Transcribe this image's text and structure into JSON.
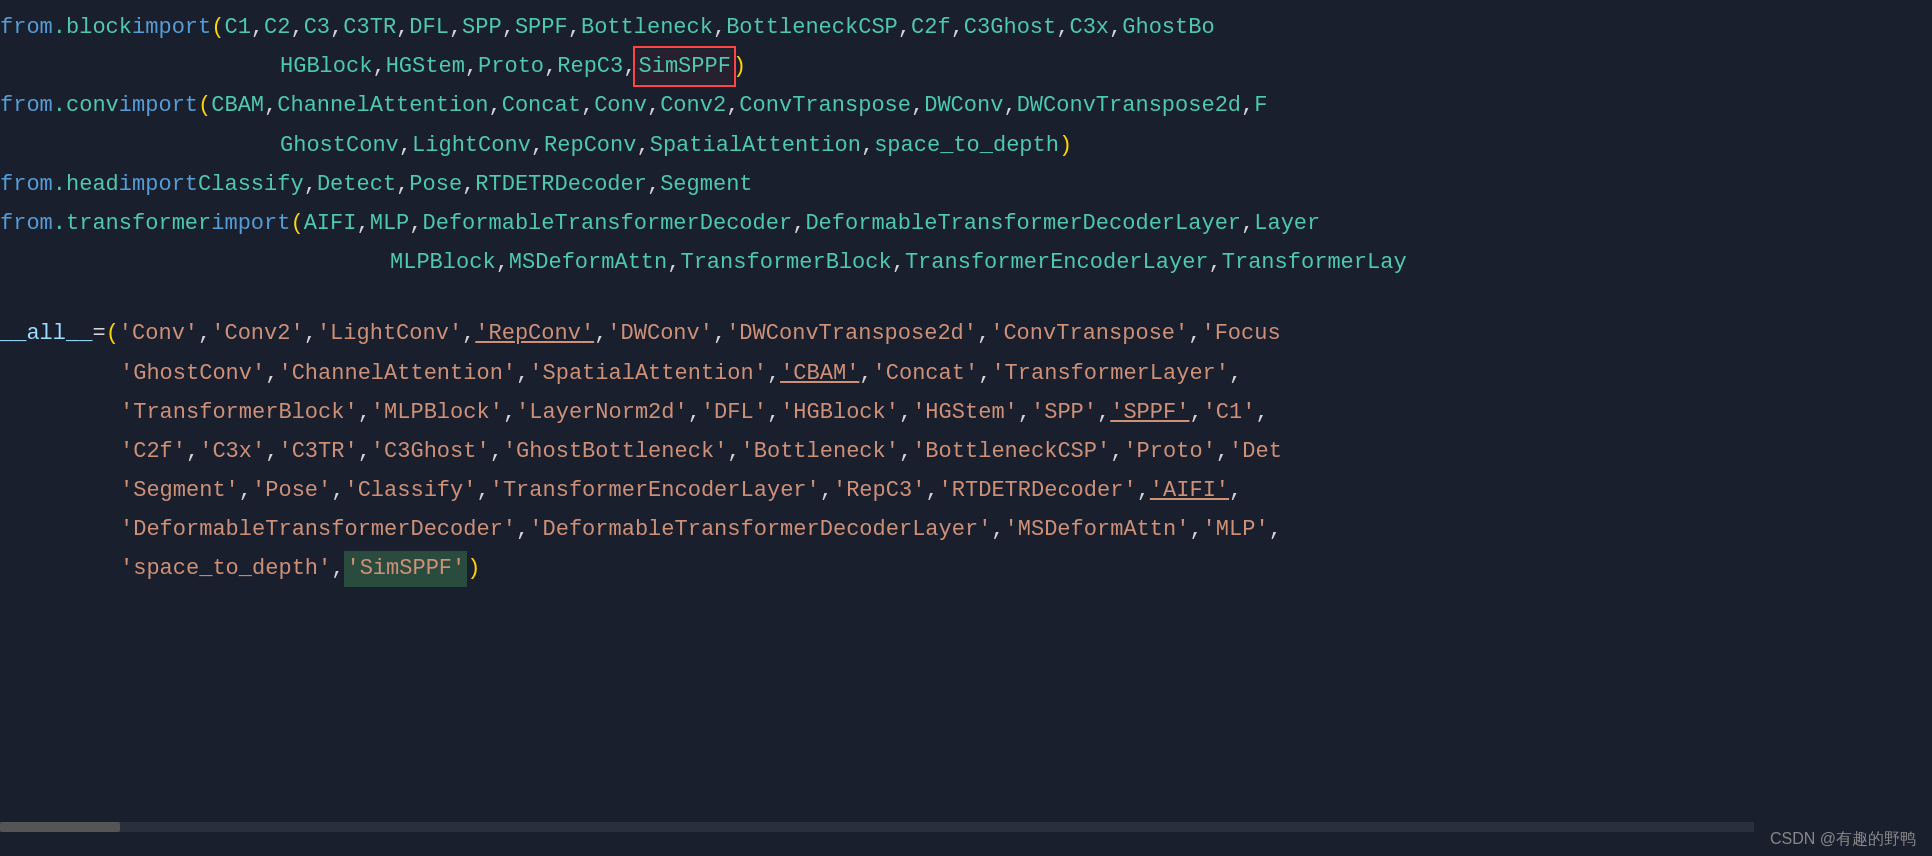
{
  "editor": {
    "background": "#1a1f2e",
    "lines": [
      {
        "id": "line1",
        "parts": [
          {
            "type": "kw-from",
            "text": "from"
          },
          {
            "type": "space",
            "text": " "
          },
          {
            "type": "module",
            "text": ".block"
          },
          {
            "type": "space",
            "text": " "
          },
          {
            "type": "kw-import",
            "text": "import"
          },
          {
            "type": "space",
            "text": " "
          },
          {
            "type": "paren",
            "text": "("
          },
          {
            "type": "classname",
            "text": "C1"
          },
          {
            "type": "comma",
            "text": ", "
          },
          {
            "type": "classname",
            "text": "C2"
          },
          {
            "type": "comma",
            "text": ", "
          },
          {
            "type": "classname",
            "text": "C3"
          },
          {
            "type": "comma",
            "text": ", "
          },
          {
            "type": "classname",
            "text": "C3TR"
          },
          {
            "type": "comma",
            "text": ", "
          },
          {
            "type": "classname",
            "text": "DFL"
          },
          {
            "type": "comma",
            "text": ", "
          },
          {
            "type": "classname",
            "text": "SPP"
          },
          {
            "type": "comma",
            "text": ", "
          },
          {
            "type": "classname",
            "text": "SPPF"
          },
          {
            "type": "comma",
            "text": ", "
          },
          {
            "type": "classname",
            "text": "Bottleneck"
          },
          {
            "type": "comma",
            "text": ", "
          },
          {
            "type": "classname",
            "text": "BottleneckCSP"
          },
          {
            "type": "comma",
            "text": ", "
          },
          {
            "type": "classname",
            "text": "C2f"
          },
          {
            "type": "comma",
            "text": ", "
          },
          {
            "type": "classname",
            "text": "C3Ghost"
          },
          {
            "type": "comma",
            "text": ", "
          },
          {
            "type": "classname",
            "text": "C3x"
          },
          {
            "type": "comma",
            "text": ", "
          },
          {
            "type": "classname",
            "text": "GhostBo"
          }
        ]
      },
      {
        "id": "line2",
        "parts": [
          {
            "type": "indent-large",
            "text": "                    "
          },
          {
            "type": "classname",
            "text": "HGBlock"
          },
          {
            "type": "comma",
            "text": ", "
          },
          {
            "type": "classname",
            "text": "HGStem"
          },
          {
            "type": "comma",
            "text": ", "
          },
          {
            "type": "classname",
            "text": "Proto"
          },
          {
            "type": "comma",
            "text": ", "
          },
          {
            "type": "classname",
            "text": "RepC3"
          },
          {
            "type": "comma",
            "text": ", "
          },
          {
            "type": "classname-highlighted",
            "text": "SimSPPF"
          },
          {
            "type": "paren",
            "text": ")"
          }
        ]
      },
      {
        "id": "line3",
        "parts": [
          {
            "type": "kw-from",
            "text": "from"
          },
          {
            "type": "space",
            "text": " "
          },
          {
            "type": "module",
            "text": ".conv"
          },
          {
            "type": "space",
            "text": " "
          },
          {
            "type": "kw-import",
            "text": "import"
          },
          {
            "type": "space",
            "text": " "
          },
          {
            "type": "paren",
            "text": "("
          },
          {
            "type": "classname",
            "text": "CBAM"
          },
          {
            "type": "comma",
            "text": ", "
          },
          {
            "type": "classname",
            "text": "ChannelAttention"
          },
          {
            "type": "comma",
            "text": ", "
          },
          {
            "type": "classname",
            "text": "Concat"
          },
          {
            "type": "comma",
            "text": ", "
          },
          {
            "type": "classname",
            "text": "Conv"
          },
          {
            "type": "comma",
            "text": ", "
          },
          {
            "type": "classname",
            "text": "Conv2"
          },
          {
            "type": "comma",
            "text": ", "
          },
          {
            "type": "classname",
            "text": "ConvTranspose"
          },
          {
            "type": "comma",
            "text": ", "
          },
          {
            "type": "classname",
            "text": "DWConv"
          },
          {
            "type": "comma",
            "text": ", "
          },
          {
            "type": "classname",
            "text": "DWConvTranspose2d"
          },
          {
            "type": "comma",
            "text": ", "
          },
          {
            "type": "classname",
            "text": "F"
          }
        ]
      },
      {
        "id": "line4",
        "parts": [
          {
            "type": "indent-large",
            "text": "                    "
          },
          {
            "type": "classname",
            "text": "GhostConv"
          },
          {
            "type": "comma",
            "text": ", "
          },
          {
            "type": "classname",
            "text": "LightConv"
          },
          {
            "type": "comma",
            "text": ", "
          },
          {
            "type": "classname",
            "text": "RepConv"
          },
          {
            "type": "comma",
            "text": ", "
          },
          {
            "type": "classname",
            "text": "SpatialAttention"
          },
          {
            "type": "comma",
            "text": ", "
          },
          {
            "type": "classname",
            "text": "space_to_depth"
          },
          {
            "type": "paren",
            "text": ")"
          }
        ]
      },
      {
        "id": "line5",
        "parts": [
          {
            "type": "kw-from",
            "text": "from"
          },
          {
            "type": "space",
            "text": " "
          },
          {
            "type": "module",
            "text": ".head"
          },
          {
            "type": "space",
            "text": " "
          },
          {
            "type": "kw-import",
            "text": "import"
          },
          {
            "type": "space",
            "text": " "
          },
          {
            "type": "classname",
            "text": "Classify"
          },
          {
            "type": "comma",
            "text": ", "
          },
          {
            "type": "classname",
            "text": "Detect"
          },
          {
            "type": "comma",
            "text": ", "
          },
          {
            "type": "classname",
            "text": "Pose"
          },
          {
            "type": "comma",
            "text": ", "
          },
          {
            "type": "classname",
            "text": "RTDETRDecoder"
          },
          {
            "type": "comma",
            "text": ", "
          },
          {
            "type": "classname",
            "text": "Segment"
          }
        ]
      },
      {
        "id": "line6",
        "parts": [
          {
            "type": "kw-from",
            "text": "from"
          },
          {
            "type": "space",
            "text": " "
          },
          {
            "type": "module",
            "text": ".transformer"
          },
          {
            "type": "space",
            "text": " "
          },
          {
            "type": "kw-import",
            "text": "import"
          },
          {
            "type": "space",
            "text": " "
          },
          {
            "type": "paren",
            "text": "("
          },
          {
            "type": "classname",
            "text": "AIFI"
          },
          {
            "type": "comma",
            "text": ", "
          },
          {
            "type": "classname",
            "text": "MLP"
          },
          {
            "type": "comma",
            "text": ", "
          },
          {
            "type": "classname",
            "text": "DeformableTransformerDecoder"
          },
          {
            "type": "comma",
            "text": ", "
          },
          {
            "type": "classname",
            "text": "DeformableTransformerDecoderLayer"
          },
          {
            "type": "comma",
            "text": ", "
          },
          {
            "type": "classname",
            "text": "Layer"
          }
        ]
      },
      {
        "id": "line7",
        "parts": [
          {
            "type": "indent-large",
            "text": "                    "
          },
          {
            "type": "classname",
            "text": "MLPBlock"
          },
          {
            "type": "comma",
            "text": ", "
          },
          {
            "type": "classname",
            "text": "MSDeformAttn"
          },
          {
            "type": "comma",
            "text": ", "
          },
          {
            "type": "classname",
            "text": "TransformerBlock"
          },
          {
            "type": "comma",
            "text": ", "
          },
          {
            "type": "classname",
            "text": "TransformerEncoderLayer"
          },
          {
            "type": "comma",
            "text": ", "
          },
          {
            "type": "classname",
            "text": "TransformerLay"
          }
        ]
      },
      {
        "id": "line8-empty",
        "empty": true
      },
      {
        "id": "line9",
        "parts": [
          {
            "type": "variable",
            "text": "__all__"
          },
          {
            "type": "space",
            "text": " "
          },
          {
            "type": "operator",
            "text": "="
          },
          {
            "type": "space",
            "text": " "
          },
          {
            "type": "paren",
            "text": "("
          },
          {
            "type": "string",
            "text": "'Conv'"
          },
          {
            "type": "comma",
            "text": ", "
          },
          {
            "type": "string",
            "text": "'Conv2'"
          },
          {
            "type": "comma",
            "text": ", "
          },
          {
            "type": "string",
            "text": "'LightConv'"
          },
          {
            "type": "comma",
            "text": ", "
          },
          {
            "type": "string-underline",
            "text": "'RepConv'"
          },
          {
            "type": "comma",
            "text": ", "
          },
          {
            "type": "string",
            "text": "'DWConv'"
          },
          {
            "type": "comma",
            "text": ", "
          },
          {
            "type": "string",
            "text": "'DWConvTranspose2d'"
          },
          {
            "type": "comma",
            "text": ", "
          },
          {
            "type": "string",
            "text": "'ConvTranspose'"
          },
          {
            "type": "comma",
            "text": ", "
          },
          {
            "type": "string",
            "text": "'Focus"
          }
        ]
      },
      {
        "id": "line10",
        "parts": [
          {
            "type": "indent-small",
            "text": "        "
          },
          {
            "type": "string",
            "text": "'GhostConv'"
          },
          {
            "type": "comma",
            "text": ", "
          },
          {
            "type": "string",
            "text": "'ChannelAttention'"
          },
          {
            "type": "comma",
            "text": ", "
          },
          {
            "type": "string",
            "text": "'SpatialAttention'"
          },
          {
            "type": "comma",
            "text": ", "
          },
          {
            "type": "string-underline",
            "text": "'CBAM'"
          },
          {
            "type": "comma",
            "text": ", "
          },
          {
            "type": "string",
            "text": "'Concat'"
          },
          {
            "type": "comma",
            "text": ", "
          },
          {
            "type": "string",
            "text": "'TransformerLayer'"
          },
          {
            "type": "comma",
            "text": ","
          }
        ]
      },
      {
        "id": "line11",
        "parts": [
          {
            "type": "indent-small",
            "text": "        "
          },
          {
            "type": "string",
            "text": "'TransformerBlock'"
          },
          {
            "type": "comma",
            "text": ", "
          },
          {
            "type": "string",
            "text": "'MLPBlock'"
          },
          {
            "type": "comma",
            "text": ", "
          },
          {
            "type": "string",
            "text": "'LayerNorm2d'"
          },
          {
            "type": "comma",
            "text": ", "
          },
          {
            "type": "string",
            "text": "'DFL'"
          },
          {
            "type": "comma",
            "text": ", "
          },
          {
            "type": "string",
            "text": "'HGBlock'"
          },
          {
            "type": "comma",
            "text": ", "
          },
          {
            "type": "string",
            "text": "'HGStem'"
          },
          {
            "type": "comma",
            "text": ", "
          },
          {
            "type": "string",
            "text": "'SPP'"
          },
          {
            "type": "comma",
            "text": ", "
          },
          {
            "type": "string-underline",
            "text": "'SPPF'"
          },
          {
            "type": "comma",
            "text": ", "
          },
          {
            "type": "string",
            "text": "'C1'"
          },
          {
            "type": "comma",
            "text": ","
          }
        ]
      },
      {
        "id": "line12",
        "parts": [
          {
            "type": "indent-small",
            "text": "        "
          },
          {
            "type": "string",
            "text": "'C2f'"
          },
          {
            "type": "comma",
            "text": ", "
          },
          {
            "type": "string",
            "text": "'C3x'"
          },
          {
            "type": "comma",
            "text": ", "
          },
          {
            "type": "string",
            "text": "'C3TR'"
          },
          {
            "type": "comma",
            "text": ", "
          },
          {
            "type": "string",
            "text": "'C3Ghost'"
          },
          {
            "type": "comma",
            "text": ", "
          },
          {
            "type": "string",
            "text": "'GhostBottleneck'"
          },
          {
            "type": "comma",
            "text": ", "
          },
          {
            "type": "string",
            "text": "'Bottleneck'"
          },
          {
            "type": "comma",
            "text": ", "
          },
          {
            "type": "string",
            "text": "'BottleneckCSP'"
          },
          {
            "type": "comma",
            "text": ", "
          },
          {
            "type": "string",
            "text": "'Proto'"
          },
          {
            "type": "comma",
            "text": ", "
          },
          {
            "type": "string",
            "text": "'Det"
          }
        ]
      },
      {
        "id": "line13",
        "parts": [
          {
            "type": "indent-small",
            "text": "        "
          },
          {
            "type": "string",
            "text": "'Segment'"
          },
          {
            "type": "comma",
            "text": ", "
          },
          {
            "type": "string",
            "text": "'Pose'"
          },
          {
            "type": "comma",
            "text": ", "
          },
          {
            "type": "string",
            "text": "'Classify'"
          },
          {
            "type": "comma",
            "text": ", "
          },
          {
            "type": "string",
            "text": "'TransformerEncoderLayer'"
          },
          {
            "type": "comma",
            "text": ", "
          },
          {
            "type": "string",
            "text": "'RepC3'"
          },
          {
            "type": "comma",
            "text": ", "
          },
          {
            "type": "string",
            "text": "'RTDETRDecoder'"
          },
          {
            "type": "comma",
            "text": ", "
          },
          {
            "type": "string-underline",
            "text": "'AIFI'"
          },
          {
            "type": "comma",
            "text": ","
          }
        ]
      },
      {
        "id": "line14",
        "parts": [
          {
            "type": "indent-small",
            "text": "        "
          },
          {
            "type": "string",
            "text": "'DeformableTransformerDecoder'"
          },
          {
            "type": "comma",
            "text": ", "
          },
          {
            "type": "string",
            "text": "'DeformableTransformerDecoderLayer'"
          },
          {
            "type": "comma",
            "text": ", "
          },
          {
            "type": "string",
            "text": "'MSDeformAttn'"
          },
          {
            "type": "comma",
            "text": ", "
          },
          {
            "type": "string",
            "text": "'MLP'"
          },
          {
            "type": "comma",
            "text": ","
          }
        ]
      },
      {
        "id": "line15",
        "parts": [
          {
            "type": "indent-small",
            "text": "        "
          },
          {
            "type": "string",
            "text": "'space_to_depth'"
          },
          {
            "type": "comma",
            "text": ", "
          },
          {
            "type": "string-highlighted",
            "text": "'SimSPPF'"
          },
          {
            "type": "paren",
            "text": ")"
          }
        ]
      }
    ],
    "watermark": "CSDN @有趣的野鸭"
  }
}
